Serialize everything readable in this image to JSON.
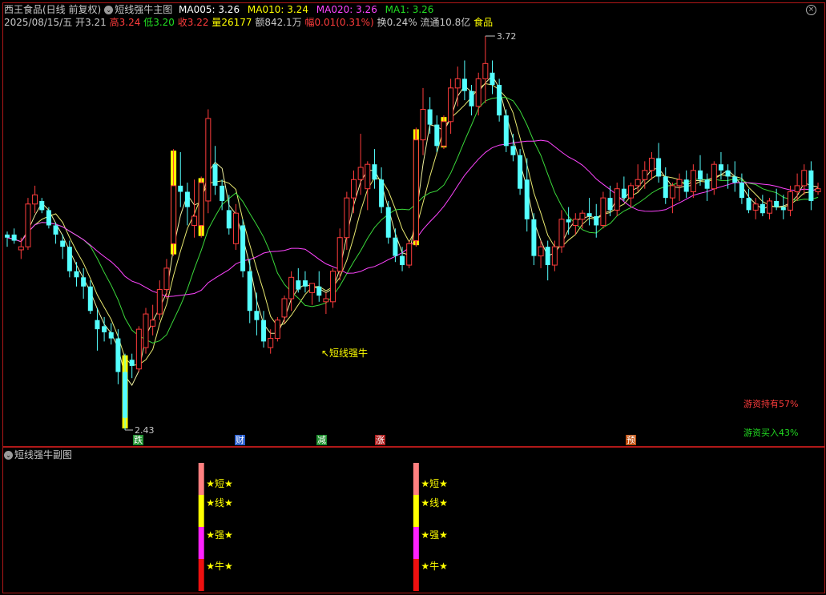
{
  "header": {
    "stock": "西王食品(日线 前复权)",
    "indicator": "短线强牛主图",
    "ma005_label": "MA005: 3.26",
    "ma010_label": "MA010: 3.24",
    "ma020_label": "MA020: 3.26",
    "ma1_label": "MA1: 3.26",
    "date": "2025/08/15/五",
    "open_label": "开",
    "open": "3.21",
    "high_label": "高",
    "high": "3.24",
    "low_label": "低",
    "low": "3.20",
    "close_label": "收",
    "close": "3.22",
    "vol_label": "量",
    "vol": "26177",
    "amt": "额842.1万",
    "chg_label": "幅",
    "chg": "0.01(0.31%)",
    "turnover": "换0.24%",
    "float_cap": "流通10.8亿",
    "sector": "食品"
  },
  "annotations": {
    "high_mark": "3.72",
    "low_mark": "2.43",
    "signal_label": "↖短线强牛",
    "hot_hold": "游资持有57%",
    "hot_buy": "游资买入43%"
  },
  "tags": [
    {
      "text": "跌",
      "color": "#1f8f2f"
    },
    {
      "text": "财",
      "color": "#2a5fd0"
    },
    {
      "text": "减",
      "color": "#1f8f2f"
    },
    {
      "text": "涨",
      "color": "#b02020"
    },
    {
      "text": "预",
      "color": "#c05010"
    }
  ],
  "sub": {
    "title": "短线强牛副图",
    "labels": [
      "★短★",
      "★线★",
      "★强★",
      "★牛★"
    ]
  },
  "colors": {
    "up": "#ff3c3c",
    "down": "#54ffff",
    "ma5": "#ffffff",
    "ma10": "#ffff00",
    "ma20": "#ff44ff",
    "ma1": "#22dd22",
    "signal": "#ffff00"
  },
  "chart_data": {
    "type": "candlestick",
    "ylim": [
      2.43,
      3.72
    ],
    "candles": [
      [
        3.07,
        3.08,
        3.03,
        3.06
      ],
      [
        3.07,
        3.09,
        3.04,
        3.05
      ],
      [
        3.02,
        3.06,
        2.99,
        3.03
      ],
      [
        3.03,
        3.19,
        3.02,
        3.17
      ],
      [
        3.17,
        3.23,
        3.14,
        3.2
      ],
      [
        3.18,
        3.19,
        3.14,
        3.15
      ],
      [
        3.15,
        3.16,
        3.09,
        3.1
      ],
      [
        3.1,
        3.11,
        3.04,
        3.07
      ],
      [
        3.05,
        3.07,
        2.99,
        3.03
      ],
      [
        3.03,
        3.05,
        2.93,
        2.95
      ],
      [
        2.95,
        2.98,
        2.9,
        2.93
      ],
      [
        2.93,
        2.96,
        2.86,
        2.9
      ],
      [
        2.9,
        2.92,
        2.81,
        2.82
      ],
      [
        2.79,
        2.83,
        2.69,
        2.76
      ],
      [
        2.77,
        2.8,
        2.72,
        2.75
      ],
      [
        2.75,
        2.78,
        2.71,
        2.73
      ],
      [
        2.73,
        2.76,
        2.58,
        2.62
      ],
      [
        2.62,
        2.68,
        2.43,
        2.47
      ],
      [
        2.66,
        2.68,
        2.6,
        2.64
      ],
      [
        2.63,
        2.77,
        2.62,
        2.76
      ],
      [
        2.7,
        2.83,
        2.68,
        2.81
      ],
      [
        2.77,
        2.84,
        2.74,
        2.79
      ],
      [
        2.81,
        2.92,
        2.79,
        2.89
      ],
      [
        2.89,
        2.99,
        2.86,
        2.96
      ],
      [
        3.04,
        3.35,
        3.0,
        3.23
      ],
      [
        3.23,
        3.34,
        3.16,
        3.21
      ],
      [
        3.21,
        3.24,
        3.1,
        3.16
      ],
      [
        3.1,
        3.25,
        3.06,
        3.13
      ],
      [
        3.1,
        3.26,
        3.06,
        3.24
      ],
      [
        3.18,
        3.48,
        3.14,
        3.45
      ],
      [
        3.3,
        3.36,
        3.2,
        3.23
      ],
      [
        3.23,
        3.25,
        3.15,
        3.18
      ],
      [
        3.15,
        3.2,
        3.07,
        3.09
      ],
      [
        3.04,
        3.17,
        3.02,
        3.14
      ],
      [
        3.1,
        3.12,
        2.93,
        2.95
      ],
      [
        2.95,
        2.99,
        2.78,
        2.82
      ],
      [
        2.82,
        2.88,
        2.74,
        2.79
      ],
      [
        2.79,
        2.82,
        2.7,
        2.72
      ],
      [
        2.7,
        2.76,
        2.68,
        2.73
      ],
      [
        2.73,
        2.8,
        2.72,
        2.79
      ],
      [
        2.8,
        2.87,
        2.78,
        2.86
      ],
      [
        2.86,
        2.95,
        2.82,
        2.93
      ],
      [
        2.92,
        2.96,
        2.88,
        2.89
      ],
      [
        2.92,
        2.95,
        2.88,
        2.9
      ],
      [
        2.88,
        2.91,
        2.84,
        2.91
      ],
      [
        2.9,
        2.95,
        2.85,
        2.87
      ],
      [
        2.85,
        2.88,
        2.81,
        2.86
      ],
      [
        2.85,
        2.96,
        2.83,
        2.95
      ],
      [
        2.95,
        3.09,
        2.92,
        3.06
      ],
      [
        3.06,
        3.21,
        3.02,
        3.19
      ],
      [
        3.19,
        3.28,
        3.14,
        3.25
      ],
      [
        3.25,
        3.4,
        3.2,
        3.29
      ],
      [
        3.22,
        3.31,
        3.15,
        3.3
      ],
      [
        3.3,
        3.35,
        3.22,
        3.25
      ],
      [
        3.25,
        3.29,
        3.14,
        3.16
      ],
      [
        3.16,
        3.18,
        3.04,
        3.06
      ],
      [
        3.06,
        3.09,
        2.98,
        3.0
      ],
      [
        3.0,
        3.03,
        2.95,
        2.97
      ],
      [
        2.97,
        3.05,
        2.96,
        3.04
      ],
      [
        3.05,
        3.42,
        3.03,
        3.38
      ],
      [
        3.38,
        3.55,
        3.33,
        3.48
      ],
      [
        3.48,
        3.52,
        3.4,
        3.43
      ],
      [
        3.43,
        3.46,
        3.34,
        3.36
      ],
      [
        3.36,
        3.46,
        3.35,
        3.44
      ],
      [
        3.44,
        3.58,
        3.4,
        3.55
      ],
      [
        3.55,
        3.62,
        3.49,
        3.58
      ],
      [
        3.58,
        3.64,
        3.51,
        3.54
      ],
      [
        3.54,
        3.56,
        3.46,
        3.49
      ],
      [
        3.49,
        3.6,
        3.46,
        3.58
      ],
      [
        3.58,
        3.72,
        3.5,
        3.63
      ],
      [
        3.6,
        3.64,
        3.53,
        3.56
      ],
      [
        3.56,
        3.58,
        3.44,
        3.46
      ],
      [
        3.46,
        3.48,
        3.34,
        3.36
      ],
      [
        3.36,
        3.4,
        3.31,
        3.33
      ],
      [
        3.33,
        3.35,
        3.2,
        3.22
      ],
      [
        3.25,
        3.32,
        3.08,
        3.12
      ],
      [
        3.12,
        3.14,
        2.97,
        3.0
      ],
      [
        3.0,
        3.05,
        2.96,
        3.03
      ],
      [
        3.03,
        3.05,
        2.92,
        2.97
      ],
      [
        2.97,
        3.05,
        2.95,
        3.03
      ],
      [
        3.03,
        3.15,
        3.01,
        3.12
      ],
      [
        3.12,
        3.16,
        3.07,
        3.11
      ],
      [
        3.1,
        3.14,
        3.07,
        3.12
      ],
      [
        3.12,
        3.15,
        3.09,
        3.14
      ],
      [
        3.14,
        3.19,
        3.1,
        3.13
      ],
      [
        3.13,
        3.17,
        3.06,
        3.1
      ],
      [
        3.1,
        3.21,
        3.09,
        3.19
      ],
      [
        3.19,
        3.23,
        3.13,
        3.15
      ],
      [
        3.15,
        3.24,
        3.13,
        3.22
      ],
      [
        3.22,
        3.26,
        3.18,
        3.19
      ],
      [
        3.19,
        3.24,
        3.16,
        3.23
      ],
      [
        3.23,
        3.3,
        3.21,
        3.25
      ],
      [
        3.25,
        3.31,
        3.22,
        3.28
      ],
      [
        3.28,
        3.34,
        3.25,
        3.32
      ],
      [
        3.32,
        3.37,
        3.24,
        3.26
      ],
      [
        3.26,
        3.29,
        3.17,
        3.19
      ],
      [
        3.19,
        3.24,
        3.14,
        3.23
      ],
      [
        3.23,
        3.27,
        3.18,
        3.25
      ],
      [
        3.25,
        3.28,
        3.19,
        3.21
      ],
      [
        3.21,
        3.3,
        3.19,
        3.28
      ],
      [
        3.28,
        3.33,
        3.23,
        3.25
      ],
      [
        3.25,
        3.27,
        3.18,
        3.22
      ],
      [
        3.22,
        3.31,
        3.2,
        3.3
      ],
      [
        3.3,
        3.34,
        3.25,
        3.28
      ],
      [
        3.28,
        3.3,
        3.22,
        3.26
      ],
      [
        3.26,
        3.31,
        3.21,
        3.24
      ],
      [
        3.24,
        3.27,
        3.17,
        3.19
      ],
      [
        3.19,
        3.22,
        3.14,
        3.15
      ],
      [
        3.15,
        3.19,
        3.12,
        3.17
      ],
      [
        3.17,
        3.2,
        3.13,
        3.14
      ],
      [
        3.14,
        3.19,
        3.12,
        3.18
      ],
      [
        3.18,
        3.22,
        3.15,
        3.16
      ],
      [
        3.16,
        3.2,
        3.12,
        3.15
      ],
      [
        3.15,
        3.23,
        3.13,
        3.21
      ],
      [
        3.21,
        3.27,
        3.18,
        3.23
      ],
      [
        3.23,
        3.3,
        3.2,
        3.28
      ],
      [
        3.28,
        3.31,
        3.15,
        3.18
      ],
      [
        3.21,
        3.24,
        3.2,
        3.22
      ]
    ],
    "signal_bars": [
      17,
      24,
      28,
      59,
      63
    ],
    "signal_red": [
      59
    ],
    "sub_signals": [
      28,
      59
    ]
  }
}
